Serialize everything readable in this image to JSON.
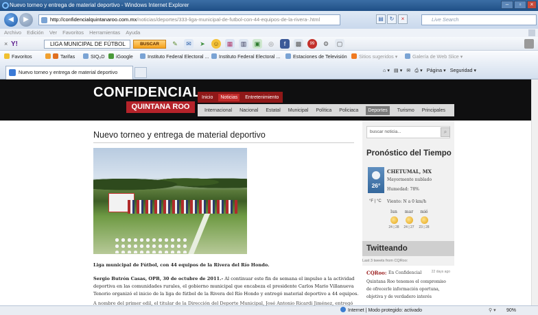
{
  "window": {
    "title": "Nuevo torneo y entrega de material deportivo - Windows Internet Explorer"
  },
  "address": {
    "url_host": "http://confidencialquintanaroo.com.mx",
    "url_path": "/noticias/deportes/333-liga-municipal-de-futbol-con-44-equipos-de-la-rivera-.html",
    "search_placeholder": "Live Search"
  },
  "menu": [
    "Archivo",
    "Edición",
    "Ver",
    "Favoritos",
    "Herramientas",
    "Ayuda"
  ],
  "yahoo": {
    "logo": "Y!",
    "search_value": "LIGA MUNICIPAL DE FÚTBOL",
    "search_button": "BUSCAR"
  },
  "favorites": {
    "label": "Favoritos",
    "items": [
      "Tarifas",
      "SIQ₀D",
      "iGoogle",
      "Instituto Federal Electoral ...",
      "Instituto Federal Electoral ...",
      "Estaciones de Televisión",
      "Sitios sugeridos ▾",
      "Galería de Web Slice ▾"
    ]
  },
  "tabs": {
    "active": "Nuevo torneo y entrega de material deportivo"
  },
  "commands": {
    "page": "Página ▾",
    "safety": "Seguridad ▾"
  },
  "site": {
    "logo_line1": "CONFIDENCIAL",
    "logo_line2": "QUINTANA ROO",
    "top_nav": [
      "Inicio",
      "Noticias",
      "Entretenimiento"
    ],
    "top_nav_active": 1,
    "sub_nav": [
      "Internacional",
      "Nacional",
      "Estatal",
      "Municipal",
      "Política",
      "Policiaca",
      "Deportes",
      "Turismo",
      "Principales"
    ],
    "sub_nav_active": 6
  },
  "article": {
    "title": "Nuevo torneo y entrega de material deportivo",
    "caption": "Liga municipal de Fútbol, con 44 equipos de la Rivera del Río Hondo.",
    "lead": "Sergio Butrón Casas, OPB, 30 de octubre de 2011.-",
    "para1": " Al continuar este fin de semana el impulso a la actividad deportiva en las comunidades rurales, el gobierno municipal que encabeza el presidente Carlos Mario Villanueva Tenorio organizó el inicio de la liga de fútbol de la Rivera del Río Hondo y entregó material deportivo a 44 equipos.",
    "para2": "A nombre del primer edil, el titular de la Dirección del Deporte Municipal, José Antonio Ricardi Jiménez, entregó balones y"
  },
  "sidebar": {
    "search_placeholder": "buscar noticia...",
    "weather_heading": "Pronóstico del Tiempo",
    "city": "CHETUMAL, MX",
    "temp": "26°",
    "condition": "Mayormente nublado",
    "humidity": "Humedad: 78%",
    "units": "°F | °C",
    "wind": "Viento: N a 0 km/h",
    "forecast": [
      {
        "day": "lun",
        "temps": "24 | 28"
      },
      {
        "day": "mar",
        "temps": "24 | 27"
      },
      {
        "day": "mié",
        "temps": "23 | 28"
      }
    ],
    "twitter_heading": "Twitteando",
    "twitter_last": "Last 3 tweets from CQRoo:",
    "tweet_user": "CQRoo:",
    "tweet_user_rest": "En Confidencial",
    "tweet_time": "22 days ago",
    "tweet_text": "Quintana Roo tenemos el compromiso de ofrecerle información oportuna, objetiva y de verdadero interés"
  },
  "status": {
    "zone": "Internet | Modo protegido: activado",
    "zoom": "90%"
  }
}
